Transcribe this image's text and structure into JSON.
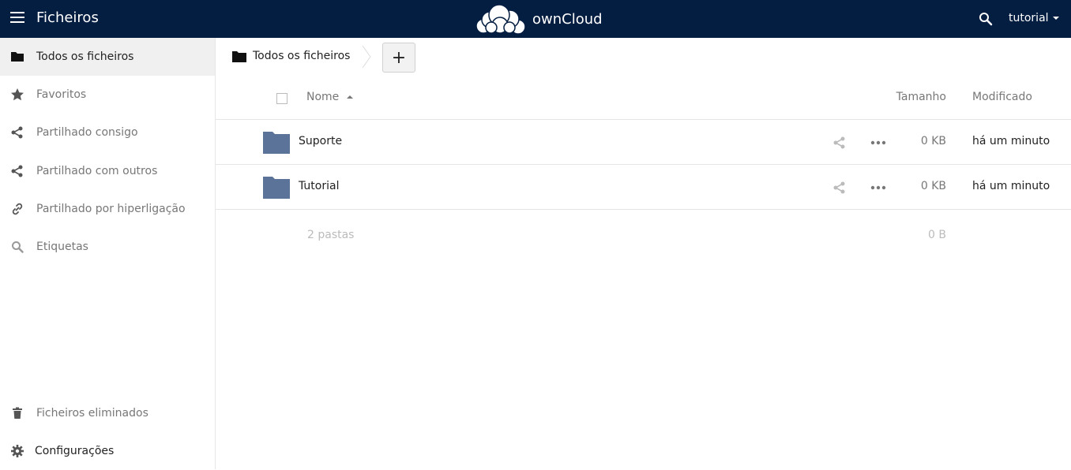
{
  "header": {
    "app_title": "Ficheiros",
    "logo_text": "ownCloud",
    "user": "tutorial",
    "bg_color": "#041e42"
  },
  "sidebar": {
    "items": [
      {
        "label": "Todos os ficheiros",
        "icon": "folder-icon",
        "active": true
      },
      {
        "label": "Favoritos",
        "icon": "star-icon"
      },
      {
        "label": "Partilhado consigo",
        "icon": "share-icon"
      },
      {
        "label": "Partilhado com outros",
        "icon": "share-icon"
      },
      {
        "label": "Partilhado por hiperligação",
        "icon": "link-icon"
      },
      {
        "label": "Etiquetas",
        "icon": "search-icon"
      }
    ],
    "bottom": [
      {
        "label": "Ficheiros eliminados",
        "icon": "trash-icon"
      },
      {
        "label": "Configurações",
        "icon": "gear-icon"
      }
    ]
  },
  "breadcrumb": {
    "label": "Todos os ficheiros",
    "new_label": "+"
  },
  "table": {
    "headers": {
      "name": "Nome",
      "size": "Tamanho",
      "modified": "Modificado"
    },
    "rows": [
      {
        "name": "Suporte",
        "size": "0 KB",
        "modified": "há um minuto"
      },
      {
        "name": "Tutorial",
        "size": "0 KB",
        "modified": "há um minuto"
      }
    ],
    "summary": {
      "count": "2 pastas",
      "total": "0 B"
    }
  },
  "colors": {
    "folder": "#5b7399",
    "accent": "#041e42"
  }
}
